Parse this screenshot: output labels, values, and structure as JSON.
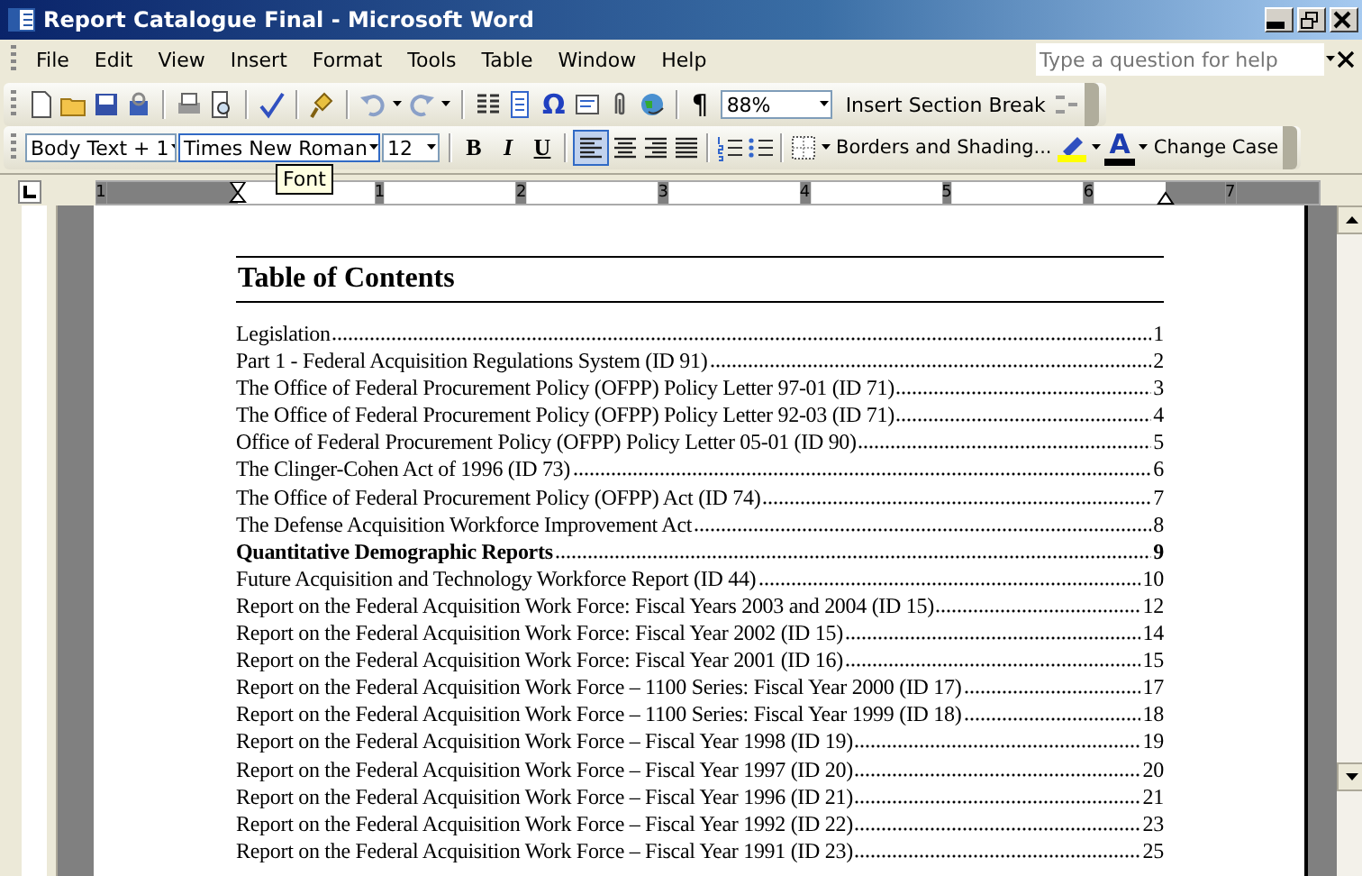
{
  "window": {
    "title": "Report Catalogue Final - Microsoft Word"
  },
  "menu": [
    "File",
    "Edit",
    "View",
    "Insert",
    "Format",
    "Tools",
    "Table",
    "Window",
    "Help"
  ],
  "help_box": {
    "placeholder": "Type a question for help"
  },
  "standard_toolbar": {
    "symbol": "Ω",
    "pilcrow": "¶",
    "zoom": "88%",
    "section_break_button": "Insert Section Break"
  },
  "formatting_toolbar": {
    "style": "Body Text + 1",
    "font": "Times New Roman",
    "size": "12",
    "bold": "B",
    "italic": "I",
    "underline": "U",
    "borders_button": "Borders and Shading...",
    "font_color": "A",
    "change_case_button": "Change Case",
    "tooltip": "Font"
  },
  "ruler": [
    "1",
    "1",
    "2",
    "3",
    "4",
    "5",
    "6",
    "7"
  ],
  "document": {
    "heading": "Table of Contents",
    "entries": [
      {
        "title": "Legislation",
        "page": "1",
        "bold": false
      },
      {
        "title": "Part 1 - Federal Acquisition Regulations System (ID 91)",
        "page": "2",
        "bold": false
      },
      {
        "title": "The Office of Federal Procurement Policy (OFPP) Policy Letter 97-01 (ID 71)",
        "page": "3",
        "bold": false
      },
      {
        "title": "The Office of Federal Procurement Policy (OFPP) Policy Letter 92-03 (ID 71)",
        "page": "4",
        "bold": false
      },
      {
        "title": "Office of Federal Procurement Policy (OFPP) Policy Letter 05-01 (ID 90)",
        "page": "5",
        "bold": false
      },
      {
        "title": "The Clinger-Cohen Act of 1996 (ID 73)",
        "page": "6",
        "bold": false
      },
      {
        "title": "The Office of Federal Procurement Policy (OFPP) Act (ID 74)",
        "page": "7",
        "bold": false
      },
      {
        "title": "The Defense Acquisition Workforce Improvement Act",
        "page": "8",
        "bold": false
      },
      {
        "title": "Quantitative Demographic Reports",
        "page": "9",
        "bold": true
      },
      {
        "title": "Future Acquisition and Technology Workforce Report (ID 44)",
        "page": "10",
        "bold": false
      },
      {
        "title": "Report on the Federal Acquisition Work Force: Fiscal Years 2003 and 2004 (ID 15)",
        "page": "12",
        "bold": false
      },
      {
        "title": "Report on the Federal Acquisition Work Force: Fiscal Year 2002 (ID 15)",
        "page": "14",
        "bold": false
      },
      {
        "title": "Report on the Federal Acquisition Work Force: Fiscal Year 2001 (ID 16)",
        "page": "15",
        "bold": false
      },
      {
        "title": "Report on the Federal Acquisition Work Force – 1100 Series: Fiscal Year 2000 (ID 17)",
        "page": "17",
        "bold": false
      },
      {
        "title": "Report on the Federal Acquisition Work Force – 1100 Series: Fiscal Year 1999 (ID 18)",
        "page": "18",
        "bold": false
      },
      {
        "title": "Report on the Federal Acquisition Work Force – Fiscal Year 1998 (ID 19)",
        "page": "19",
        "bold": false
      },
      {
        "title": "Report on the Federal Acquisition Work Force – Fiscal Year 1997 (ID 20)",
        "page": "20",
        "bold": false
      },
      {
        "title": "Report on the Federal Acquisition Work Force – Fiscal Year 1996 (ID 21)",
        "page": "21",
        "bold": false
      },
      {
        "title": "Report on the Federal Acquisition Work Force – Fiscal Year 1992 (ID 22)",
        "page": "23",
        "bold": false
      },
      {
        "title": "Report on the Federal Acquisition Work Force – Fiscal Year 1991 (ID 23)",
        "page": "25",
        "bold": false
      }
    ]
  }
}
